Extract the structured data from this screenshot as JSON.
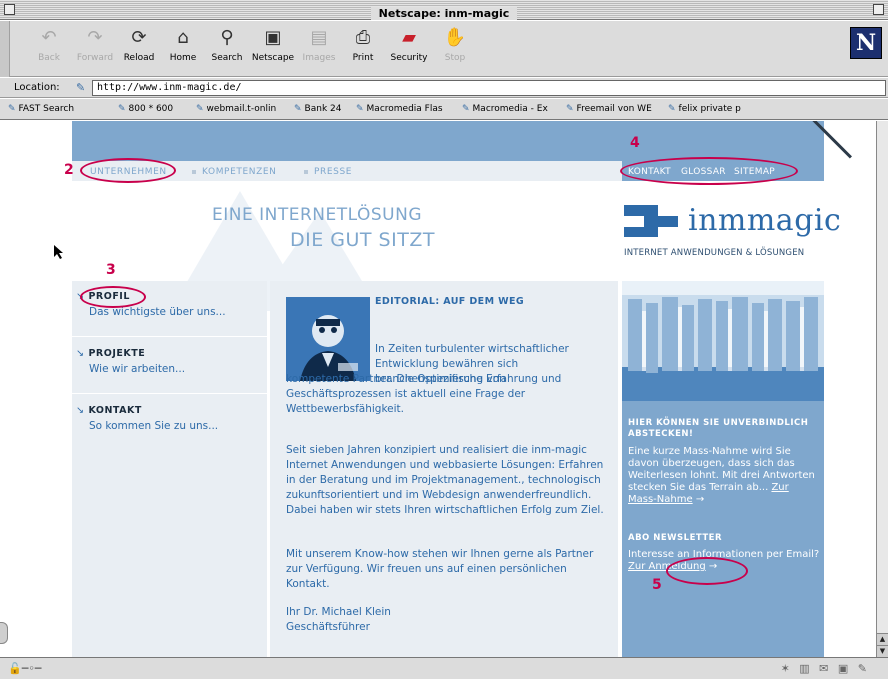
{
  "window": {
    "title": "Netscape: inm-magic"
  },
  "toolbar": {
    "buttons": [
      {
        "label": "Back",
        "icon": "back-arrow-icon",
        "disabled": true
      },
      {
        "label": "Forward",
        "icon": "forward-arrow-icon",
        "disabled": true
      },
      {
        "label": "Reload",
        "icon": "reload-icon",
        "disabled": false
      },
      {
        "label": "Home",
        "icon": "home-icon",
        "disabled": false
      },
      {
        "label": "Search",
        "icon": "search-icon",
        "disabled": false
      },
      {
        "label": "Netscape",
        "icon": "netscape-icon",
        "disabled": false
      },
      {
        "label": "Images",
        "icon": "images-icon",
        "disabled": true
      },
      {
        "label": "Print",
        "icon": "print-icon",
        "disabled": false
      },
      {
        "label": "Security",
        "icon": "security-lock-icon",
        "disabled": false
      },
      {
        "label": "Stop",
        "icon": "stop-icon",
        "disabled": true
      }
    ],
    "logo": "N"
  },
  "location": {
    "label": "Location:",
    "url": "http://www.inm-magic.de/"
  },
  "bookmarks": [
    "FAST Search",
    "800 * 600",
    "webmail.t-onlin",
    "Bank 24",
    "Macromedia Flas",
    "Macromedia - Ex",
    "Freemail von WE",
    "felix private p"
  ],
  "site": {
    "nav": [
      "UNTERNEHMEN",
      "KOMPETENZEN",
      "PRESSE"
    ],
    "util": [
      "KONTAKT",
      "GLOSSAR",
      "SITEMAP"
    ],
    "slogan_line1": "EINE INTERNETLÖSUNG",
    "slogan_line2": "DIE GUT SITZT",
    "brand_name": "inmmagic",
    "brand_tagline": "INTERNET ANWENDUNGEN & LÖSUNGEN",
    "sections": [
      {
        "title": "PROFIL",
        "subtitle": "Das wichtigste über uns..."
      },
      {
        "title": "PROJEKTE",
        "subtitle": "Wie wir arbeiten..."
      },
      {
        "title": "KONTAKT",
        "subtitle": "So kommen Sie zu uns..."
      }
    ],
    "editorial": {
      "headline": "EDITORIAL: AUF DEM WEG",
      "p1a": "In Zeiten turbulenter wirtschaftlicher Entwicklung bewähren sich branchenspezifische Erfahrung und",
      "p1b": "kompetente Partner. Die Optimierung von Geschäftsprozessen ist aktuell eine Frage der Wettbewerbsfähigkeit.",
      "p2": "Seit sieben Jahren konzipiert und realisiert die inm-magic Internet Anwendungen und webbasierte Lösungen: Erfahren in der Beratung und im Projektmanagement., technologisch zukunftsorientiert und im Webdesign anwenderfreundlich. Dabei haben wir stets Ihren wirtschaftlichen Erfolg zum Ziel.",
      "p3": "Mit unserem Know-how stehen wir Ihnen gerne als Partner zur Verfügung. Wir freuen uns auf einen persönlichen Kontakt.",
      "signature": "Ihr Dr. Michael Klein",
      "role": "Geschäftsführer"
    },
    "sidebar": {
      "massnahme_head": "HIER KÖNNEN SIE UNVERBINDLICH ABSTECKEN!",
      "massnahme_body": "Eine kurze Mass-Nahme wird Sie davon überzeugen, dass sich das Weiterlesen lohnt. Mit drei Antworten stecken Sie das Terrain ab...",
      "massnahme_link": "Zur Mass-Nahme",
      "newsletter_head": "ABO NEWSLETTER",
      "newsletter_body": "Interesse an Informationen per Email?",
      "newsletter_link": "Zur Anmeldung",
      "arrow": "→"
    }
  },
  "annotations": [
    "2",
    "3",
    "4",
    "5"
  ],
  "colors": {
    "site_blue": "#7fa7cd",
    "text_blue": "#2d6aa8",
    "annotation": "#c8004b"
  }
}
